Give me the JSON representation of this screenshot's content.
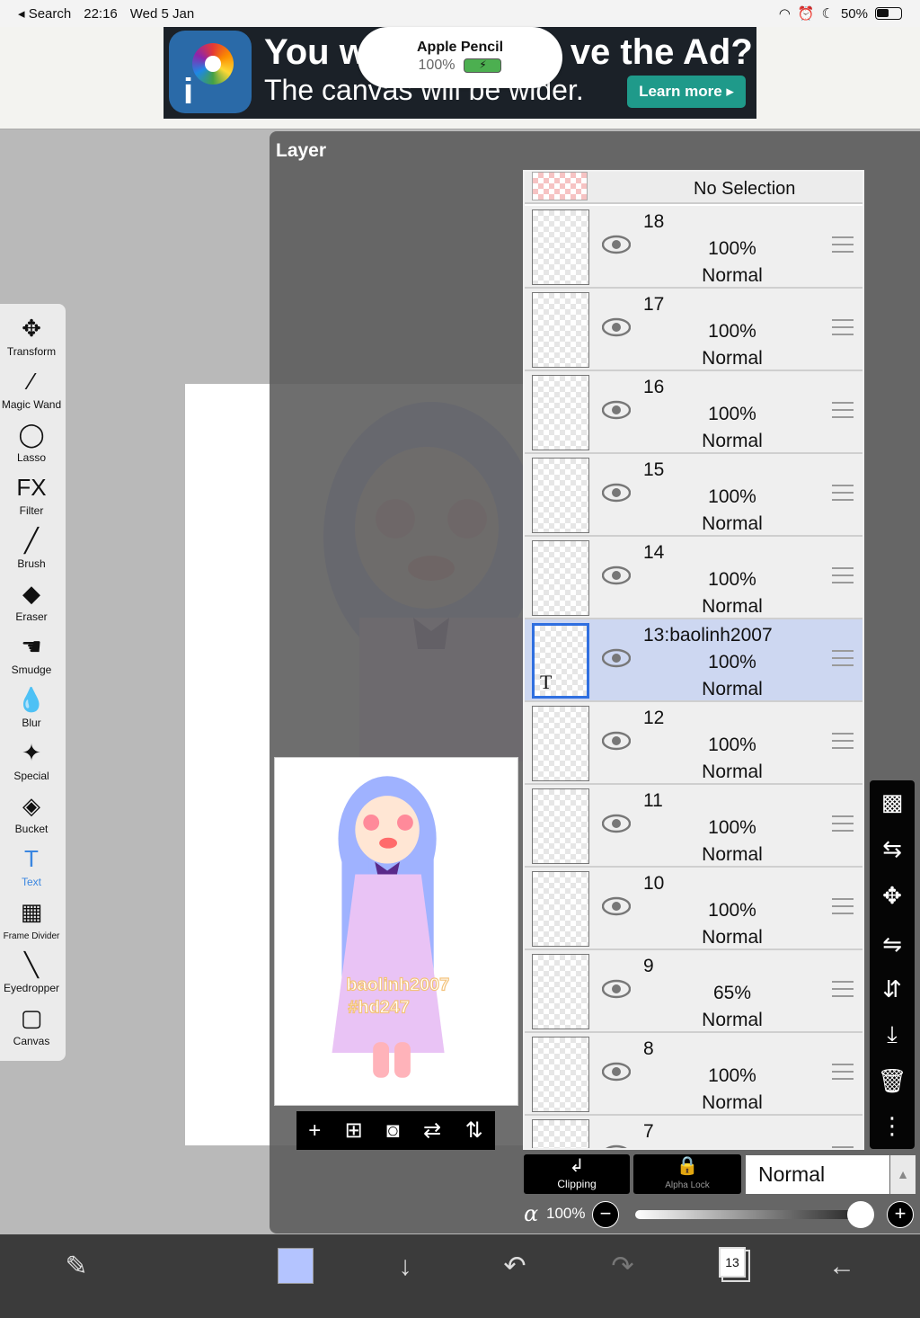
{
  "status": {
    "back_app": "Search",
    "time": "22:16",
    "date": "Wed 5 Jan",
    "battery_percent": "50%"
  },
  "ad": {
    "headline_left": "You w",
    "headline_right": "ve the Ad?",
    "subline": "The canvas will be wider.",
    "learn_more": "Learn more ▸",
    "pencil_title": "Apple Pencil",
    "pencil_percent": "100%"
  },
  "toolbar": {
    "tools": [
      {
        "label": "Transform",
        "icon": "✥"
      },
      {
        "label": "Magic Wand",
        "icon": "⁄"
      },
      {
        "label": "Lasso",
        "icon": "◯"
      },
      {
        "label": "Filter",
        "icon": "FX"
      },
      {
        "label": "Brush",
        "icon": "╱"
      },
      {
        "label": "Eraser",
        "icon": "◆"
      },
      {
        "label": "Smudge",
        "icon": "☚"
      },
      {
        "label": "Blur",
        "icon": "💧"
      },
      {
        "label": "Special",
        "icon": "✦"
      },
      {
        "label": "Bucket",
        "icon": "◈"
      },
      {
        "label": "Text",
        "icon": "T"
      },
      {
        "label": "Frame Divider",
        "icon": "▦"
      },
      {
        "label": "Eyedropper",
        "icon": "╲"
      },
      {
        "label": "Canvas",
        "icon": "▢"
      }
    ]
  },
  "layer_panel": {
    "title": "Layer",
    "no_selection": "No Selection",
    "layers": [
      {
        "name": "18",
        "opacity": "100%",
        "blend": "Normal"
      },
      {
        "name": "17",
        "opacity": "100%",
        "blend": "Normal"
      },
      {
        "name": "16",
        "opacity": "100%",
        "blend": "Normal"
      },
      {
        "name": "15",
        "opacity": "100%",
        "blend": "Normal"
      },
      {
        "name": "14",
        "opacity": "100%",
        "blend": "Normal"
      },
      {
        "name": "13:baolinh2007",
        "opacity": "100%",
        "blend": "Normal"
      },
      {
        "name": "12",
        "opacity": "100%",
        "blend": "Normal"
      },
      {
        "name": "11",
        "opacity": "100%",
        "blend": "Normal"
      },
      {
        "name": "10",
        "opacity": "100%",
        "blend": "Normal"
      },
      {
        "name": "9",
        "opacity": "65%",
        "blend": "Normal"
      },
      {
        "name": "8",
        "opacity": "100%",
        "blend": "Normal"
      },
      {
        "name": "7",
        "opacity": "",
        "blend": ""
      }
    ],
    "clipping_label": "Clipping",
    "alpha_lock_label": "Alpha Lock",
    "blend_mode": "Normal",
    "alpha_symbol": "α",
    "alpha_value": "100%",
    "alpha_fraction": 1.0
  },
  "preview": {
    "watermark_line1": "baolinh2007",
    "watermark_line2": "#hd247"
  },
  "bottombar": {
    "layer_count": "13",
    "color": "#b4c4ff"
  }
}
